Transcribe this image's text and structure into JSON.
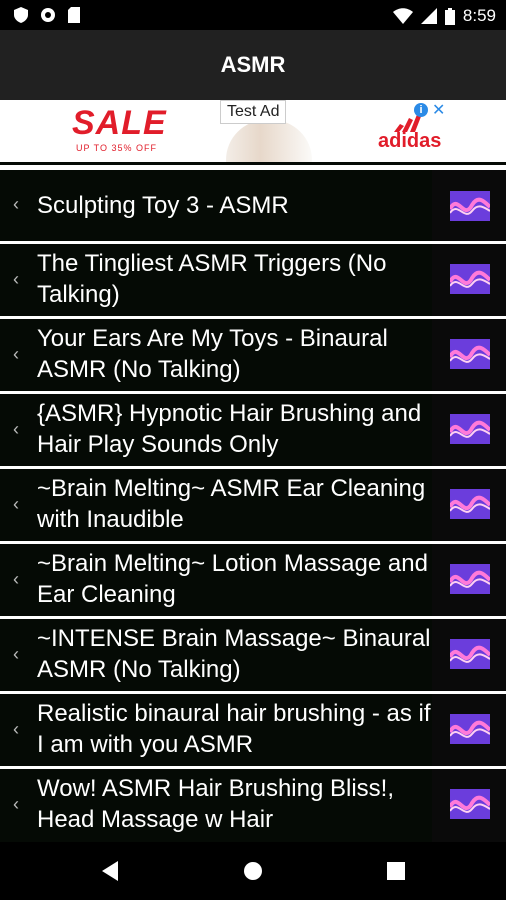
{
  "statusbar": {
    "time": "8:59"
  },
  "appbar": {
    "title": "ASMR"
  },
  "ad": {
    "sale_text": "SALE",
    "sale_sub": "UP TO 35% OFF",
    "label": "Test Ad",
    "brand": "adidas"
  },
  "list": {
    "items": [
      {
        "title": "Sculpting Toy 3 - ASMR"
      },
      {
        "title": "The Tingliest ASMR Triggers (No Talking)"
      },
      {
        "title": "Your Ears Are My Toys - Binaural ASMR (No Talking)"
      },
      {
        "title": "{ASMR} Hypnotic Hair Brushing and Hair Play Sounds Only"
      },
      {
        "title": "~Brain Melting~ ASMR Ear Cleaning with Inaudible"
      },
      {
        "title": "~Brain Melting~ Lotion Massage and Ear Cleaning"
      },
      {
        "title": "~INTENSE Brain Massage~ Binaural ASMR (No Talking)"
      },
      {
        "title": "Realistic binaural hair brushing - as if I am with you ASMR"
      },
      {
        "title": "Wow! ASMR Hair Brushing Bliss!, Head Massage w Hair"
      }
    ]
  },
  "icons": {
    "row_arrow": "chevron-left-icon",
    "row_thumb": "sound-wave-icon"
  },
  "colors": {
    "appbar": "#212121",
    "row_bg": "#050a05",
    "thumb_accent": "#8d3adf",
    "ad_red": "#e11d2a"
  }
}
